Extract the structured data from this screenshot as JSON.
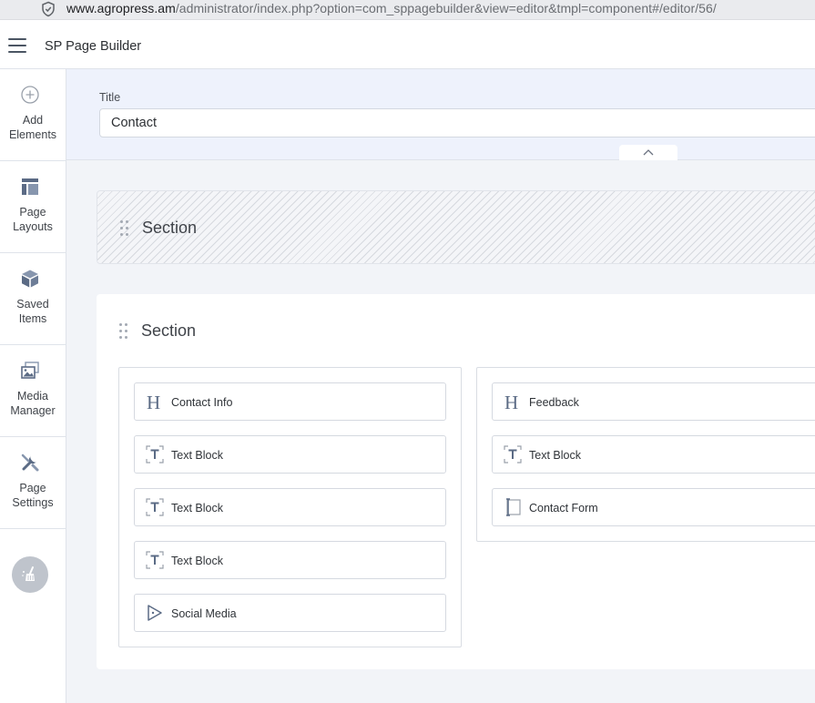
{
  "browser": {
    "url_host": "www.agropress.am",
    "url_path": "/administrator/index.php?option=com_sppagebuilder&view=editor&tmpl=component#/editor/56/"
  },
  "header": {
    "app_title": "SP Page Builder"
  },
  "sidebar": {
    "items": [
      {
        "label": "Add\nElements",
        "icon": "plus-circle-icon"
      },
      {
        "label": "Page\nLayouts",
        "icon": "layout-icon"
      },
      {
        "label": "Saved\nItems",
        "icon": "cube-icon"
      },
      {
        "label": "Media\nManager",
        "icon": "images-icon"
      },
      {
        "label": "Page\nSettings",
        "icon": "tools-icon"
      }
    ],
    "cleanup_icon": "broom-icon"
  },
  "title_panel": {
    "label": "Title",
    "value": "Contact"
  },
  "sections": [
    {
      "title": "Section",
      "style": "empty-hatched"
    },
    {
      "title": "Section",
      "columns": [
        {
          "addons": [
            {
              "name": "Contact Info",
              "icon": "heading-icon"
            },
            {
              "name": "Text Block",
              "icon": "text-block-icon"
            },
            {
              "name": "Text Block",
              "icon": "text-block-icon"
            },
            {
              "name": "Text Block",
              "icon": "text-block-icon"
            },
            {
              "name": "Social Media",
              "icon": "social-media-icon"
            }
          ]
        },
        {
          "addons": [
            {
              "name": "Feedback",
              "icon": "heading-icon"
            },
            {
              "name": "Text Block",
              "icon": "text-block-icon"
            },
            {
              "name": "Contact Form",
              "icon": "form-icon"
            }
          ]
        }
      ]
    }
  ]
}
